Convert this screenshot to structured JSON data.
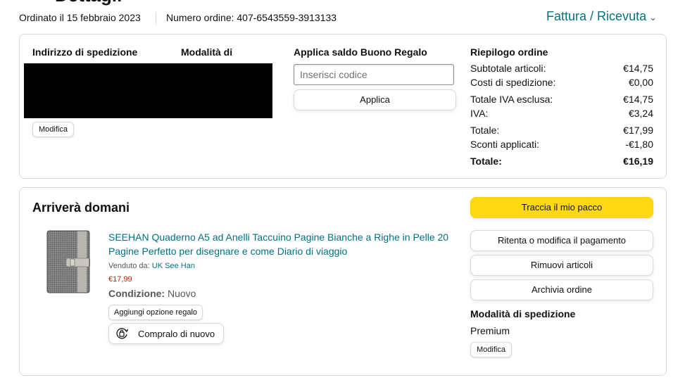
{
  "page": {
    "title_fragment": "Dettagli",
    "order_date": "Ordinato il 15 febbraio 2023",
    "order_number": "Numero ordine: 407-6543559-3913133",
    "invoice_link": "Fattura / Ricevuta"
  },
  "summary_card": {
    "shipping_address_heading": "Indirizzo di spedizione",
    "shipping_method_heading": "Modalità di",
    "edit_label": "Modifica",
    "gift_heading": "Applica saldo Buono Regalo",
    "code_placeholder": "Inserisci codice",
    "apply_label": "Applica",
    "order_summary": {
      "heading": "Riepilogo ordine",
      "rows": [
        {
          "label": "Subtotale articoli:",
          "value": "€14,75"
        },
        {
          "label": "Costi di spedizione:",
          "value": "€0,00"
        },
        {
          "label": "Totale IVA esclusa:",
          "value": "€14,75"
        },
        {
          "label": "IVA:",
          "value": "€3,24"
        },
        {
          "label": "Totale:",
          "value": "€17,99"
        },
        {
          "label": "Sconti applicati:",
          "value": "-€1,80"
        },
        {
          "label": "Totale:",
          "value": "€16,19"
        }
      ]
    }
  },
  "shipment": {
    "status": "Arriverà domani",
    "product": {
      "title": "SEEHAN Quaderno A5 ad Anelli Taccuino Pagine Bianche a Righe in Pelle 20 Pagine Perfetto per disegnare e come Diario di viaggio",
      "sold_by_label": "Venduto da:",
      "seller": "UK See Han",
      "price": "€17,99",
      "condition_label": "Condizione:",
      "condition_value": "Nuovo",
      "gift_option": "Aggiungi opzione regalo",
      "buy_again": "Compralo di nuovo"
    },
    "actions": {
      "track": "Traccia il mio pacco",
      "retry_payment": "Ritenta o modifica il pagamento",
      "remove_items": "Rimuovi articoli",
      "archive": "Archivia ordine"
    },
    "shipping_method_heading": "Modalità di spedizione",
    "shipping_method_value": "Premium",
    "edit_label": "Modifica"
  },
  "colors": {
    "link": "#007185",
    "price": "#b12704",
    "primary_button": "#ffd814",
    "border": "#d5d9d9"
  },
  "icons": [
    "chevron-down-icon",
    "buy-again-icon",
    "product-thumbnail"
  ]
}
